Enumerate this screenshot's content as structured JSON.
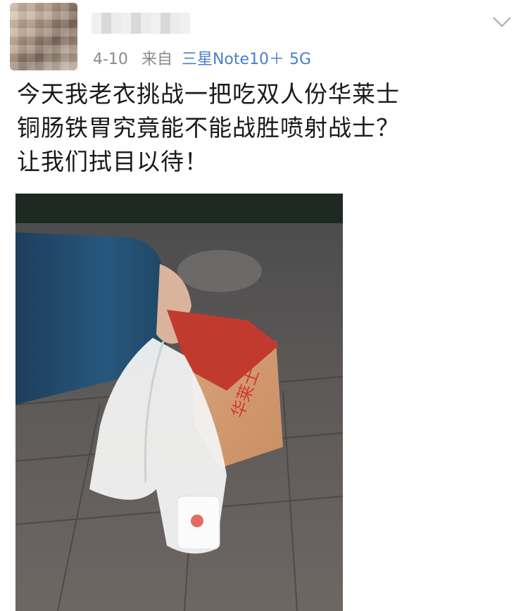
{
  "post": {
    "date": "4-10",
    "source_prefix": "来自",
    "source_device": "三星Note10＋ 5G",
    "text_lines": [
      "今天我老衣挑战一把吃双人份华莱士",
      "铜肠铁胃究竟能不能战胜喷射战士？",
      "让我们拭目以待！"
    ]
  },
  "icons": {
    "more": "chevron-down-icon"
  },
  "photo": {
    "bag_brand": "wallace",
    "bag_print": "华莱士"
  },
  "colors": {
    "source_link": "#4a7fc8",
    "meta_text": "#8a8a8a",
    "body_text": "#1a1a1a"
  }
}
